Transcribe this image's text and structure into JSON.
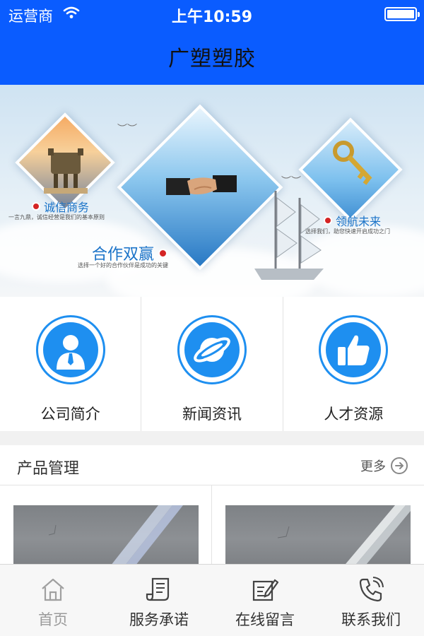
{
  "status_bar": {
    "carrier": "运营商",
    "time": "上午10:59"
  },
  "header": {
    "title": "广塑塑胶"
  },
  "banner": {
    "left_title": "诚信商务",
    "left_sub": "一言九鼎，诚信经营是我们的基本原则",
    "center_title": "合作双赢",
    "center_sub": "选择一个好的合作伙伴是成功的关键",
    "right_title": "领航未来",
    "right_sub": "选择我们，助您快速开启成功之门"
  },
  "quick_menu": [
    {
      "label": "公司简介",
      "icon": "person-icon"
    },
    {
      "label": "新闻资讯",
      "icon": "planet-icon"
    },
    {
      "label": "人才资源",
      "icon": "thumbs-up-icon"
    }
  ],
  "products": {
    "title": "产品管理",
    "more_label": "更多"
  },
  "tab_bar": [
    {
      "label": "首页",
      "icon": "home-icon",
      "active": true
    },
    {
      "label": "服务承诺",
      "icon": "scroll-icon"
    },
    {
      "label": "在线留言",
      "icon": "edit-note-icon"
    },
    {
      "label": "联系我们",
      "icon": "phone-icon"
    }
  ],
  "colors": {
    "header_bg": "#0a5cff",
    "accent": "#1e8ff0",
    "tab_inactive": "#333333",
    "tab_active": "#9a9a9a"
  }
}
